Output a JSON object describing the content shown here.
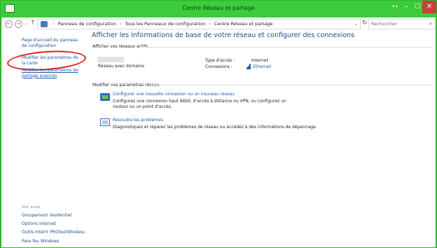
{
  "window": {
    "title": "Centre Réseau et partage",
    "extra_button": "••",
    "minimize": "–",
    "maximize": "□",
    "close": "✕"
  },
  "nav": {
    "back": "←",
    "forward": "→",
    "recent": "⌄",
    "up": "↑",
    "breadcrumbs": [
      "Panneau de configuration",
      "Tous les Panneaux de configuration",
      "Centre Réseau et partage"
    ],
    "separator": "›",
    "dropdown": "⌄",
    "refresh": "↻",
    "search_placeholder": "Rechercher",
    "search_icon": "⌕"
  },
  "sidebar": {
    "home": "Page d'accueil du panneau de configuration",
    "modify_adapter": "Modifier les paramètres de la carte",
    "modify_sharing": "Modifier les paramètres de partage avancés",
    "see_also": "Voir aussi",
    "see_also_items": [
      "Groupement résidentiel",
      "Options Internet",
      "Outils Intel® PROSet/Wireless",
      "Pare-feu Windows"
    ]
  },
  "main": {
    "title": "Afficher les informations de base de votre réseau et configurer des connexions",
    "active_networks_label": "Afficher vos réseaux actifs",
    "network_category": "Réseau avec domaine",
    "access_type_label": "Type d'accès :",
    "access_type_value": "Internet",
    "connections_label": "Connexions :",
    "connections_value": "Ethernet",
    "modify_section_label": "Modifier vos paramètres réseau",
    "tasks": [
      {
        "link": "Configurer une nouvelle connexion ou un nouveau réseau",
        "desc": "Configurez une connexion haut débit, d'accès à distance ou VPN, ou configurez un routeur ou un point d'accès."
      },
      {
        "link": "Résoudre les problèmes",
        "desc": "Diagnostiquez et réparez les problèmes de réseau ou accédez à des informations de dépannage."
      }
    ]
  },
  "colors": {
    "titlebar": "#3ccb3a",
    "link": "#1c59a8",
    "highlight_ellipse": "#e11b1b",
    "close_button": "#c7403a"
  },
  "icons": {
    "title": "network-icon",
    "address": "control-panel-icon",
    "connection": "ethernet-signal-icon",
    "task_1": "new-connection-icon",
    "task_2": "troubleshoot-icon"
  }
}
